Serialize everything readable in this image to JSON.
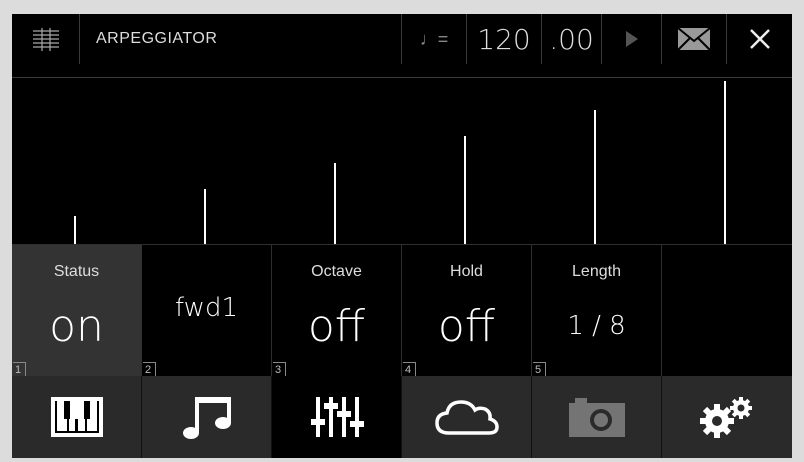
{
  "header": {
    "title": "ARPEGGIATOR",
    "tempo_icon": "♩=",
    "tempo": "120",
    "tempo_fraction": ".00",
    "play_icon": "play-icon",
    "mail_icon": "mail-icon",
    "close_icon": "close-icon",
    "score_icon": "score-icon"
  },
  "graph": {
    "values": [
      0.17,
      0.33,
      0.49,
      0.65,
      0.81,
      0.98
    ]
  },
  "params": [
    {
      "label": "Status",
      "value": "on",
      "index": "1",
      "active": true
    },
    {
      "label": "",
      "value": "fwd1",
      "index": "2",
      "active": false
    },
    {
      "label": "Octave",
      "value": "off",
      "index": "3",
      "active": false
    },
    {
      "label": "Hold",
      "value": "off",
      "index": "4",
      "active": false
    },
    {
      "label": "Length",
      "value": "1 / 8",
      "index": "5",
      "active": false
    },
    {
      "label": "",
      "value": "",
      "index": "",
      "active": false
    }
  ],
  "tabs": [
    {
      "icon": "piano-keys-icon",
      "active": false,
      "enabled": true
    },
    {
      "icon": "music-notes-icon",
      "active": false,
      "enabled": true
    },
    {
      "icon": "sliders-icon",
      "active": true,
      "enabled": true
    },
    {
      "icon": "cloud-icon",
      "active": false,
      "enabled": true
    },
    {
      "icon": "camera-icon",
      "active": false,
      "enabled": false
    },
    {
      "icon": "gears-icon",
      "active": false,
      "enabled": true
    }
  ]
}
